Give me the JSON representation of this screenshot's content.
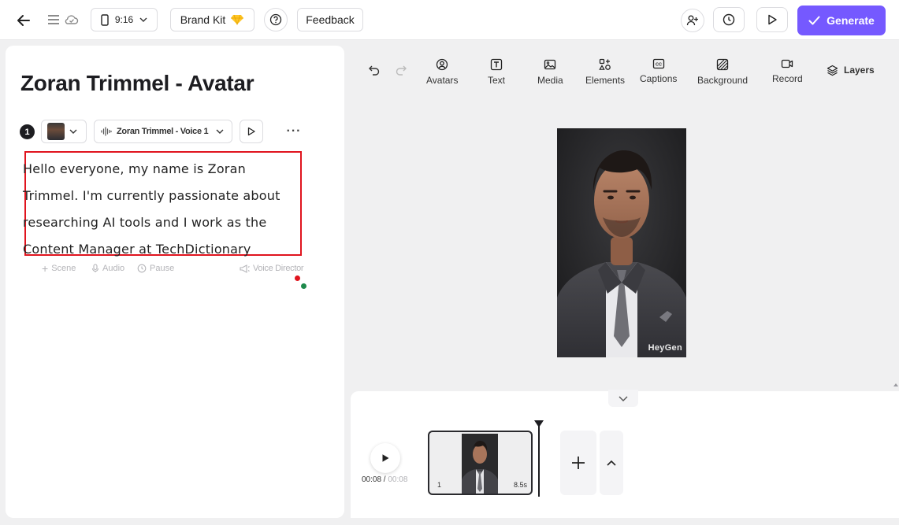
{
  "topbar": {
    "aspect_ratio": "9:16",
    "brand_kit_label": "Brand Kit",
    "feedback_label": "Feedback",
    "generate_label": "Generate"
  },
  "editor": {
    "title": "Zoran Trimmel - Avatar",
    "scene_number": "1",
    "voice_name": "Zoran Trimmel - Voice 1",
    "more_glyph": "···",
    "script_lines": [
      "Hello everyone, my name is Zoran",
      "Trimmel. I'm currently passionate about",
      "researching AI tools and I work as the",
      "Content Manager at TechDictionary"
    ],
    "tools": {
      "scene": "Scene",
      "audio": "Audio",
      "pause": "Pause",
      "voice_director": "Voice Director"
    }
  },
  "toolbar": {
    "items": [
      {
        "label": "Avatars",
        "icon": "avatar-icon"
      },
      {
        "label": "Text",
        "icon": "text-icon"
      },
      {
        "label": "Media",
        "icon": "media-icon"
      },
      {
        "label": "Elements",
        "icon": "elements-icon"
      },
      {
        "label": "Captions",
        "icon": "captions-icon"
      },
      {
        "label": "Background",
        "icon": "background-icon"
      },
      {
        "label": "Record",
        "icon": "record-icon"
      }
    ],
    "layers_label": "Layers"
  },
  "preview": {
    "watermark": "HeyGen"
  },
  "timeline": {
    "current_time": "00:08",
    "separator": " / ",
    "total_time": "00:08",
    "clip_number": "1",
    "clip_duration": "8.5s"
  },
  "colors": {
    "accent": "#7559ff",
    "highlight_box": "#e0141e",
    "dot_red": "#e0141e",
    "dot_green": "#1e8a4c"
  }
}
